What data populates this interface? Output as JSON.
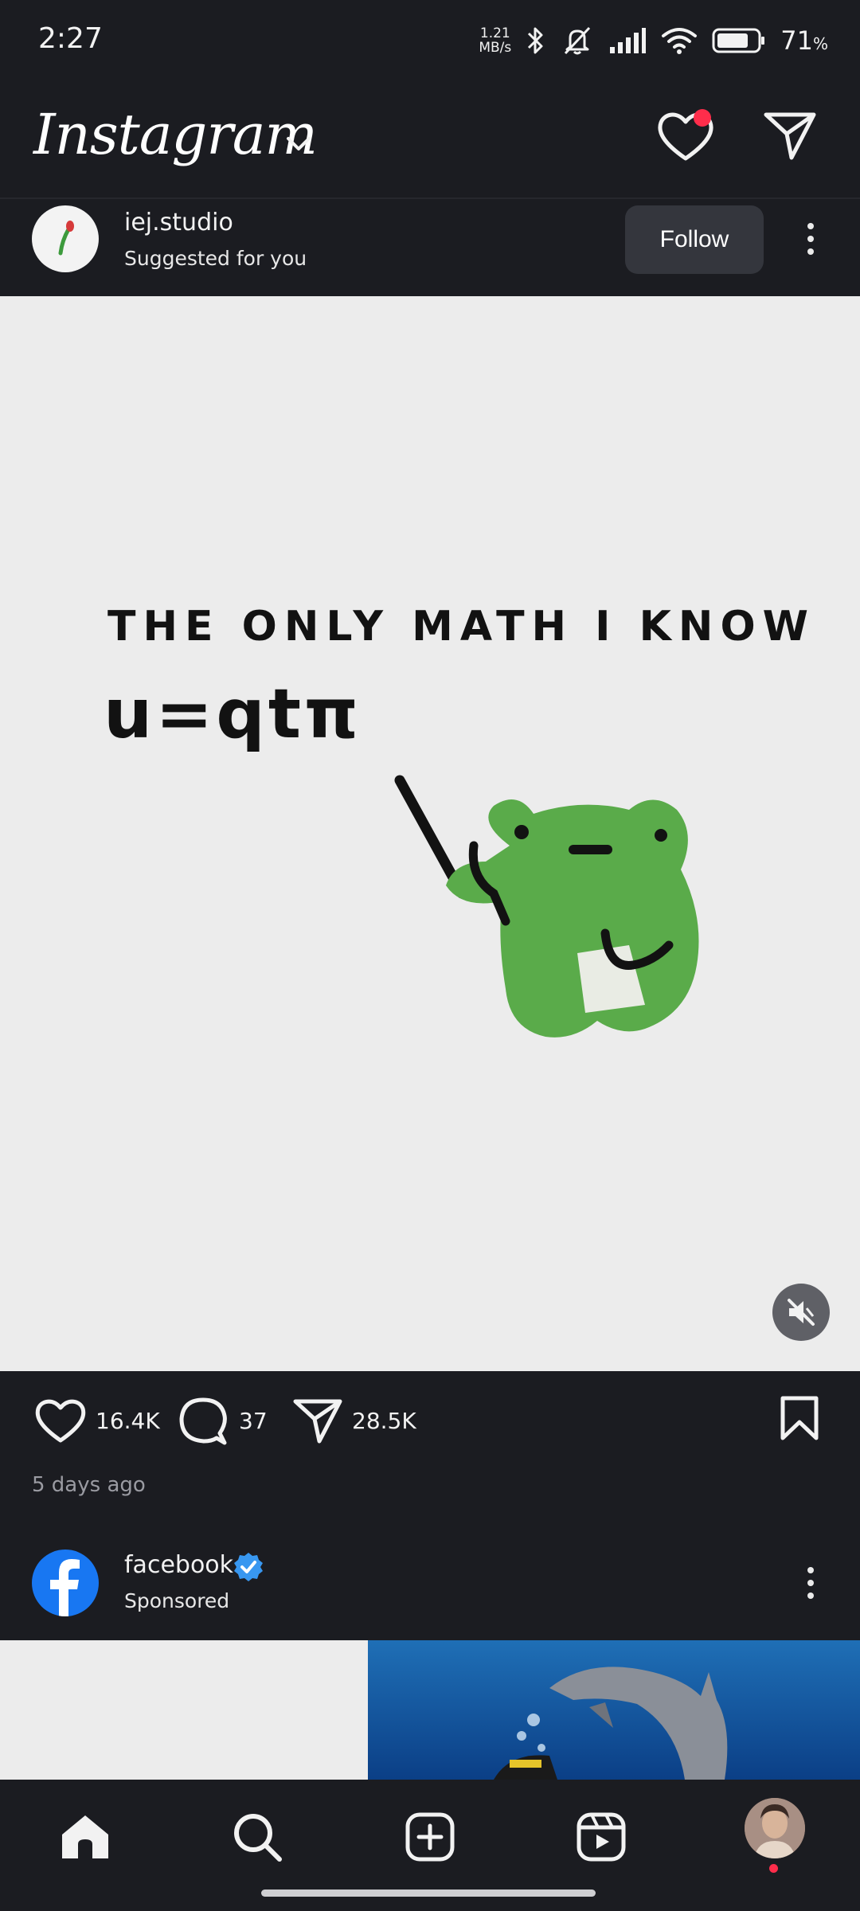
{
  "status_bar": {
    "time": "2:27",
    "net_speed_value": "1.21",
    "net_speed_unit": "MB/s",
    "battery_percent": "71",
    "battery_suffix": "%"
  },
  "header": {
    "app_title": "Instagram",
    "has_notification": true
  },
  "post1": {
    "username": "iej.studio",
    "subtitle": "Suggested for you",
    "follow_label": "Follow",
    "image_text_line1": "THE ONLY MATH I KNOW",
    "image_text_line2": "u=qtπ",
    "likes": "16.4K",
    "comments": "37",
    "shares": "28.5K",
    "posted_ago": "5 days ago",
    "muted": true
  },
  "post2": {
    "username": "facebook",
    "verified": true,
    "subtitle": "Sponsored"
  },
  "bottom_nav": {
    "items": [
      "home-icon",
      "search-icon",
      "create-icon",
      "reels-icon",
      "profile-avatar"
    ],
    "active": "home-icon"
  },
  "colors": {
    "background": "#1b1c21",
    "notification": "#ff2d4b",
    "verified": "#3897f0",
    "frog_green": "#5aab4a",
    "follow_button": "#34363d"
  }
}
